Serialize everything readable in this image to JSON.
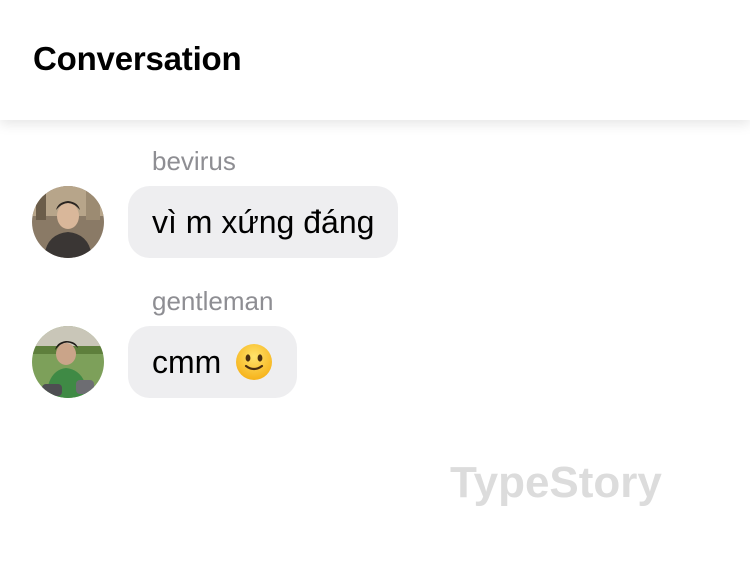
{
  "header": {
    "title": "Conversation"
  },
  "messages": [
    {
      "sender": "bevirus",
      "text": "vì m xứng đáng",
      "avatar_icon": "user-avatar-photo"
    },
    {
      "sender": "gentleman",
      "text": "cmm",
      "emoji_icon": "slightly-smiling-face-emoji",
      "avatar_icon": "user-avatar-photo"
    }
  ],
  "watermark": "TypeStory",
  "colors": {
    "background": "#ffffff",
    "bubble": "#eeeef0",
    "sender_name": "#8e8e93",
    "watermark": "#dcdcdc"
  }
}
